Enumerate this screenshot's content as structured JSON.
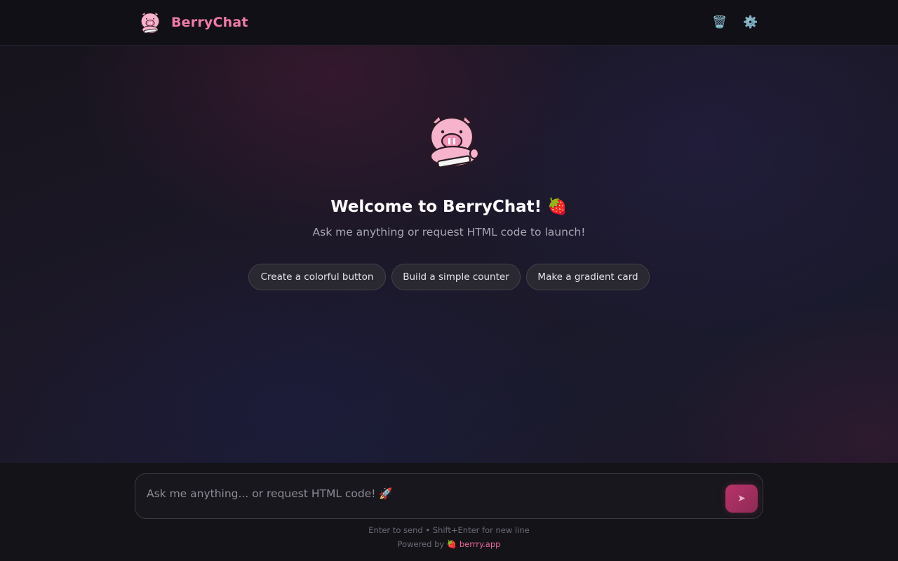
{
  "header": {
    "app_name": "BerryChat",
    "logo_icon": "pig-mascot-icon",
    "clear_icon": "trash-icon",
    "clear_glyph": "🗑️",
    "settings_icon": "gear-icon",
    "settings_glyph": "⚙️",
    "accent_color": "#f07aa8"
  },
  "welcome": {
    "mascot_icon": "pig-mascot-icon",
    "title": "Welcome to BerryChat! 🍓",
    "subtitle": "Ask me anything or request HTML code to launch!",
    "suggestions": [
      "Create a colorful button",
      "Build a simple counter",
      "Make a gradient card"
    ]
  },
  "composer": {
    "placeholder": "Ask me anything... or request HTML code! 🚀",
    "value": "",
    "send_icon": "send-arrow-icon",
    "send_glyph": "➤",
    "hint": "Enter to send • Shift+Enter for new line",
    "powered_prefix": "Powered by 🍓",
    "powered_link": "berrry.app"
  }
}
